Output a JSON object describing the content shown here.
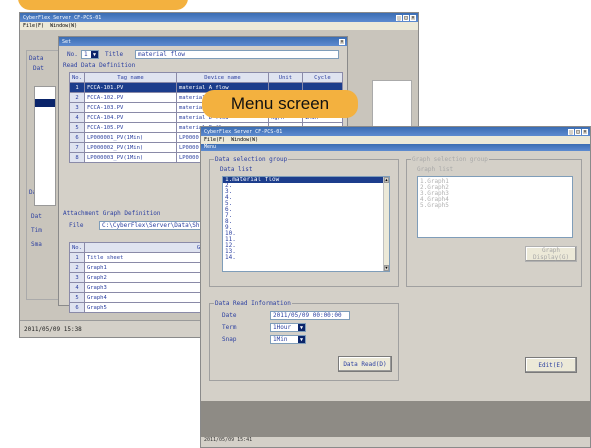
{
  "callouts": {
    "menu_screen": "Menu screen"
  },
  "back_window": {
    "title": "CyberFlex Server CF-PCS-01",
    "menu": [
      "File(F)",
      "Window(W)"
    ],
    "status": "2011/05/09  15:38",
    "panel_labels": [
      "Data",
      "Dat",
      "Data",
      "Dat",
      "Tim",
      "Sma"
    ]
  },
  "settings_window": {
    "title": "Set",
    "no_label": "No.",
    "no_value": "1",
    "title_label": "Title",
    "title_value": "material flow",
    "read_def_label": "Read Data Definition",
    "columns": [
      "No.",
      "Tag name",
      "Device name",
      "Unit",
      "Cycle"
    ],
    "rows": [
      {
        "no": "1",
        "tag": "FCCA-101.PV",
        "device": "material A flow",
        "unit": "",
        "cycle": ""
      },
      {
        "no": "2",
        "tag": "FCCA-102.PV",
        "device": "material B flow",
        "unit": "",
        "cycle": ""
      },
      {
        "no": "3",
        "tag": "FCCA-103.PV",
        "device": "material C flow",
        "unit": "",
        "cycle": ""
      },
      {
        "no": "4",
        "tag": "FCCA-104.PV",
        "device": "material D flow",
        "unit": "kg/h",
        "cycle": "1Min"
      },
      {
        "no": "5",
        "tag": "FCCA-105.PV",
        "device": "material E flow",
        "unit": "",
        "cycle": ""
      },
      {
        "no": "6",
        "tag": "LP000001_PV(1Min)",
        "device": "LP0000",
        "unit": "",
        "cycle": ""
      },
      {
        "no": "7",
        "tag": "LP000002_PV(1Min)",
        "device": "LP0000",
        "unit": "",
        "cycle": ""
      },
      {
        "no": "8",
        "tag": "LP000003_PV(1Min)",
        "device": "LP0000",
        "unit": "",
        "cycle": ""
      }
    ],
    "attach_label": "Attachment Graph Definition",
    "file_label": "File",
    "file_value": "C:\\CyberFlex\\Server\\Data\\Sh",
    "graph_columns": [
      "No.",
      "Graph name"
    ],
    "graph_rows": [
      {
        "no": "1",
        "name": "Title sheet"
      },
      {
        "no": "2",
        "name": "Graph1"
      },
      {
        "no": "3",
        "name": "Graph2"
      },
      {
        "no": "4",
        "name": "Graph3"
      },
      {
        "no": "5",
        "name": "Graph4"
      },
      {
        "no": "6",
        "name": "Graph5"
      }
    ]
  },
  "front_window": {
    "title": "CyberFlex Server CF-PCS-01",
    "menu": [
      "File(F)",
      "Window(W)"
    ],
    "child_title": "Menu",
    "data_selection_label": "Data selection group",
    "data_list_label": "Data list",
    "data_list": [
      "1.material flow",
      "2.",
      "3.",
      "4.",
      "5.",
      "6.",
      "7.",
      "8.",
      "9.",
      "10.",
      "11.",
      "12.",
      "13.",
      "14."
    ],
    "graph_selection_label": "Graph selection group",
    "graph_list_label": "Graph list",
    "graph_list": [
      "1.Graph1",
      "2.Graph2",
      "3.Graph3",
      "4.Graph4",
      "5.Graph5"
    ],
    "graph_display_label": "Graph Display(G)",
    "read_info_label": "Data Read Information",
    "date_label": "Date",
    "date_value": "2011/05/09 00:00:00",
    "term_label": "Term",
    "term_value": "1Hour",
    "snap_label": "Snap",
    "snap_value": "1Min",
    "data_read_button": "Data Read(D)",
    "edit_button": "Edit(E)",
    "status": "2011/05/09  15:41"
  }
}
